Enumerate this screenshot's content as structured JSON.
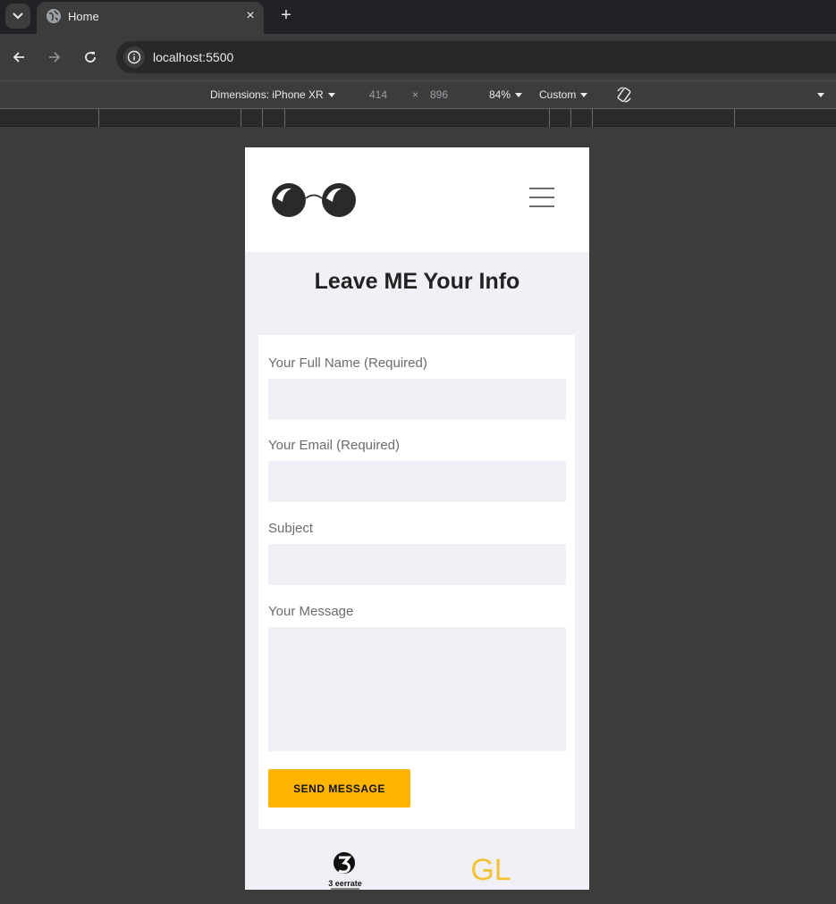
{
  "browser": {
    "tab_title": "Home",
    "tab_close": "×",
    "new_tab": "+",
    "url": "localhost:5500"
  },
  "devtools": {
    "dimensions_label": "Dimensions: iPhone XR",
    "width": "414",
    "times": "×",
    "height": "896",
    "zoom": "84%",
    "throttle": "Custom"
  },
  "page": {
    "heading": "Leave ME Your Info",
    "form": {
      "name_label": "Your Full Name (Required)",
      "email_label": "Your Email (Required)",
      "subject_label": "Subject",
      "message_label": "Your Message",
      "submit_label": "SEND MESSAGE"
    },
    "clients": {
      "logo1_text": "3 eerrate",
      "logo2_text": "GL"
    }
  },
  "colors": {
    "accent": "#ffb400",
    "page_bg": "#f1f0f6",
    "chrome_bg": "#3c3c3c"
  },
  "icons": [
    "tab-menu-icon",
    "globe-icon",
    "back-icon",
    "forward-icon",
    "reload-icon",
    "info-icon",
    "rotate-icon",
    "hamburger-icon"
  ]
}
